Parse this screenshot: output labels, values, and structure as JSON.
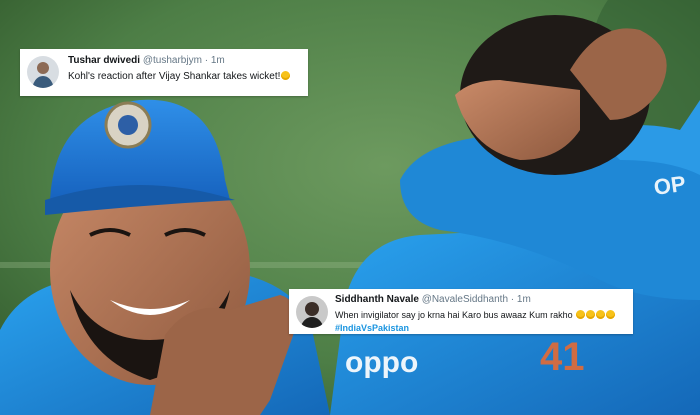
{
  "photo": {
    "sponsor": "oppo"
  },
  "tweets": [
    {
      "author": "Tushar dwivedi",
      "handle": "@tusharbjym",
      "separator": "·",
      "time": "1m",
      "text": "Kohl's reaction after Vijay Shankar takes wicket!",
      "emoji_count": 1
    },
    {
      "author": "Siddhanth Navale",
      "handle": "@NavaleSiddhanth",
      "separator": "·",
      "time": "1m",
      "text": "When invigilator say jo krna hai Karo bus awaaz Kum rakho",
      "emoji_count": 4,
      "hashtag": "#IndiaVsPakistan"
    }
  ],
  "colors": {
    "jersey": "#1a8fdc",
    "cap": "#1f7ad6",
    "grass": "#4d7e46",
    "link": "#1b95e0"
  }
}
